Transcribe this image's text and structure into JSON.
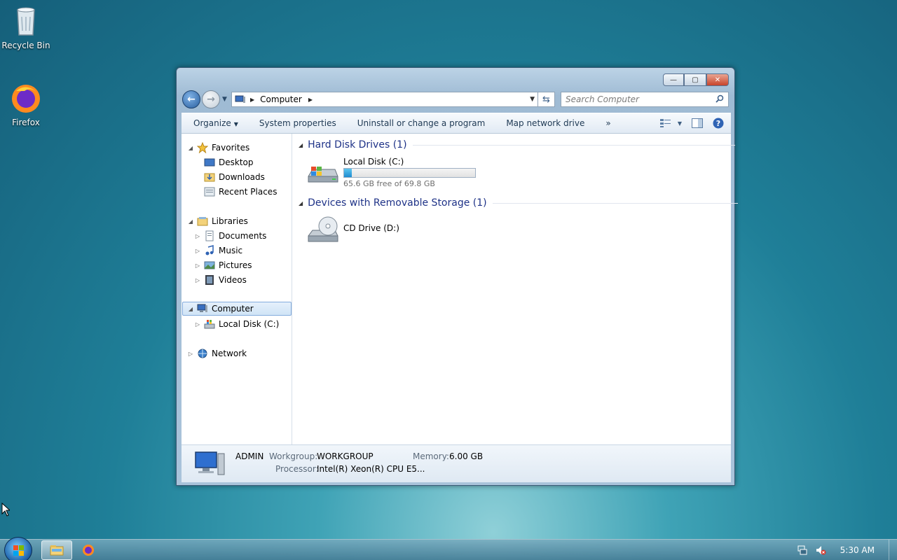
{
  "desktop": {
    "icons": [
      {
        "label": "Recycle Bin",
        "icon": "recycle-bin-icon"
      },
      {
        "label": "Firefox",
        "icon": "firefox-icon"
      }
    ]
  },
  "window": {
    "controls": {
      "minimize": "—",
      "maximize": "▢",
      "close": "✕"
    },
    "address": {
      "crumb": "Computer"
    },
    "search": {
      "placeholder": "Search Computer"
    },
    "toolbar": {
      "organize": "Organize",
      "system_properties": "System properties",
      "uninstall": "Uninstall or change a program",
      "map_drive": "Map network drive",
      "more": "»"
    },
    "nav": {
      "favorites": "Favorites",
      "desktop": "Desktop",
      "downloads": "Downloads",
      "recent_places": "Recent Places",
      "libraries": "Libraries",
      "documents": "Documents",
      "music": "Music",
      "pictures": "Pictures",
      "videos": "Videos",
      "computer": "Computer",
      "local_disk": "Local Disk (C:)",
      "network": "Network"
    },
    "groups": {
      "hdd_header": "Hard Disk Drives (1)",
      "removable_header": "Devices with Removable Storage (1)"
    },
    "drives": {
      "c_name": "Local Disk (C:)",
      "c_free": "65.6 GB free of 69.8 GB",
      "c_used_fraction": 0.06,
      "d_name": "CD Drive (D:)"
    },
    "details": {
      "name": "ADMIN",
      "workgroup_label": "Workgroup:",
      "workgroup": "WORKGROUP",
      "memory_label": "Memory:",
      "memory": "6.00 GB",
      "processor_label": "Processor:",
      "processor": "Intel(R) Xeon(R) CPU E5..."
    }
  },
  "taskbar": {
    "clock": "5:30 AM"
  },
  "colors": {
    "group_header": "#1e3287",
    "accent": "#1f8cd0"
  }
}
